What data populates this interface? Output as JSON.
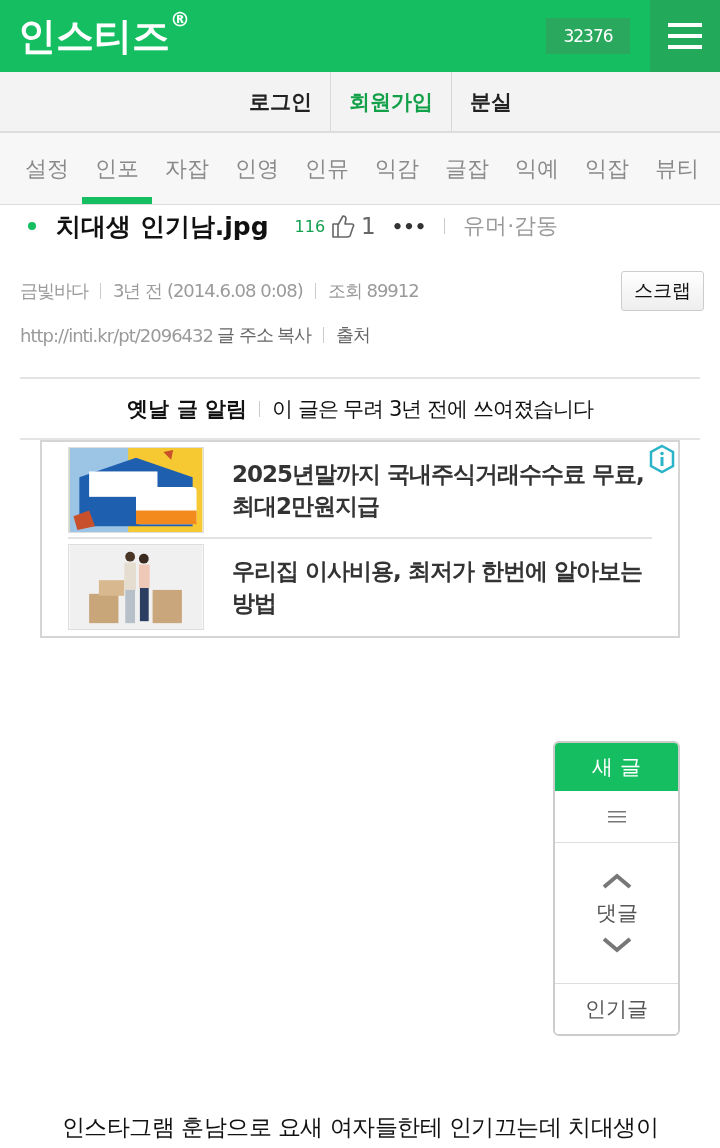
{
  "header": {
    "logo": "인스티즈",
    "logo_mark": "®",
    "counter": "32376"
  },
  "account_links": [
    {
      "label": "로그인",
      "highlight": false
    },
    {
      "label": "회원가입",
      "highlight": true
    },
    {
      "label": "분실",
      "highlight": false
    }
  ],
  "tabs": [
    {
      "label": "설정",
      "selected": false
    },
    {
      "label": "인포",
      "selected": true
    },
    {
      "label": "자잡",
      "selected": false
    },
    {
      "label": "인영",
      "selected": false
    },
    {
      "label": "인뮤",
      "selected": false
    },
    {
      "label": "익감",
      "selected": false
    },
    {
      "label": "글잡",
      "selected": false
    },
    {
      "label": "익예",
      "selected": false
    },
    {
      "label": "익잡",
      "selected": false
    },
    {
      "label": "뷰티",
      "selected": false
    }
  ],
  "post": {
    "title": "치대생 인기남.jpg",
    "score": "116",
    "likes": "1",
    "more": "•••",
    "category": "유머·감동",
    "author": "금빛바다",
    "time": "3년 전 (2014.6.08 0:08)",
    "views": "조회 89912",
    "scrap": "스크랩",
    "url": "http://inti.kr/pt/2096432",
    "copy": "글 주소 복사",
    "source": "출처"
  },
  "notice": {
    "label": "옛날 글 알림",
    "text": "이 글은 무려 3년 전에 쓰여졌습니다"
  },
  "ads": [
    {
      "kind": "picture",
      "text": "2025년말까지 국내주식거래수수료 무료, 최대2만원지급"
    },
    {
      "kind": "picture",
      "text": "우리집 이사비용, 최저가 한번에 알아보는 방법"
    }
  ],
  "float_menu": {
    "new_post": "새 글",
    "comments": "댓글",
    "popular": "인기글"
  },
  "body_text": "인스타그램 훈남으로 요새 여자들한테 인기끄는데 치대생이"
}
